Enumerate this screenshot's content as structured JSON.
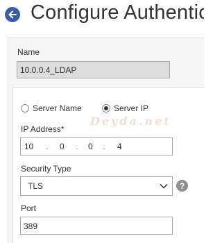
{
  "header": {
    "title": "Configure Authentica",
    "back_icon": "arrow-left-icon",
    "accent_color": "#3b5ea8"
  },
  "form": {
    "name_label": "Name",
    "name_value": "10.0.0.4_LDAP",
    "radio_server_name": "Server Name",
    "radio_server_ip": "Server IP",
    "selected_radio": "Server IP",
    "ip_label": "IP Address*",
    "ip_octets": [
      "10",
      "0",
      "0",
      "4"
    ],
    "security_label": "Security Type",
    "security_value": "TLS",
    "help_icon": "question-icon",
    "port_label": "Port",
    "port_value": "389"
  },
  "watermark": "Deyda.net"
}
